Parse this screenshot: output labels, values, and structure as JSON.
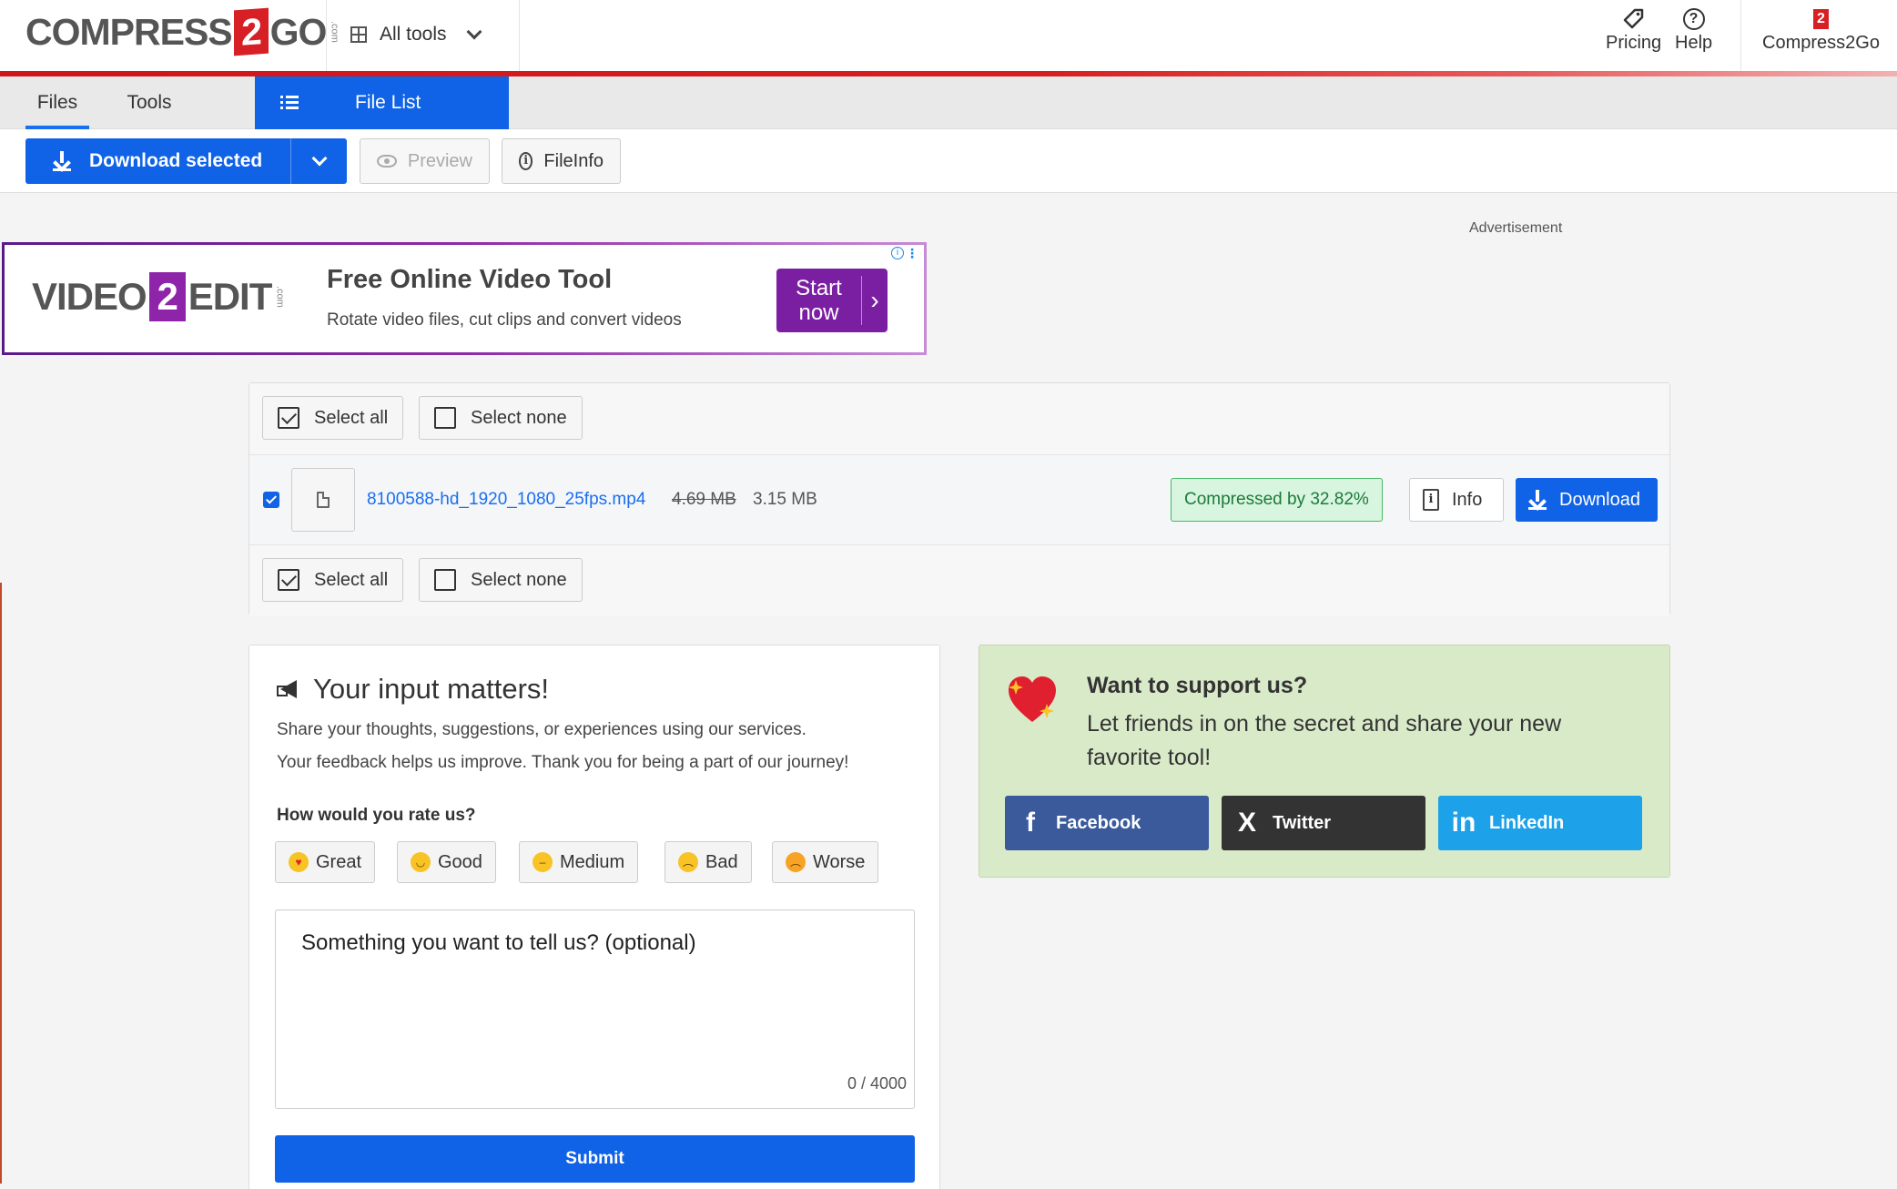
{
  "header": {
    "logo_left": "COMPRESS",
    "logo_num": "2",
    "logo_right": "GO",
    "logo_com": ".com",
    "all_tools": "All tools",
    "pricing": "Pricing",
    "help": "Help",
    "help_glyph": "?",
    "account_glyph": "2",
    "account": "Compress2Go"
  },
  "tabs": {
    "files": "Files",
    "tools": "Tools",
    "file_list": "File List"
  },
  "toolbar": {
    "download_selected": "Download selected",
    "preview": "Preview",
    "fileinfo": "FileInfo",
    "info_glyph": "i"
  },
  "ad": {
    "label": "Advertisement",
    "logo_left": "VIDEO",
    "logo_num": "2",
    "logo_right": "EDIT",
    "logo_com": ".com",
    "title": "Free Online Video Tool",
    "subtitle": "Rotate video files, cut clips and convert videos",
    "cta": "Start now",
    "cta_arrow": "›",
    "info_glyph": "i",
    "more_glyph": "⋮"
  },
  "file_list": {
    "select_all": "Select all",
    "select_none": "Select none",
    "files": [
      {
        "name": "8100588-hd_1920_1080_25fps.mp4",
        "original_size": "4.69 MB",
        "new_size": "3.15 MB",
        "status": "Compressed by 32.82%",
        "info_label": "Info",
        "info_glyph": "i",
        "download_label": "Download",
        "checked": true
      }
    ]
  },
  "feedback": {
    "title": "Your input matters!",
    "line1": "Share your thoughts, suggestions, or experiences using our services.",
    "line2": "Your feedback helps us improve. Thank you for being a part of our journey!",
    "rate_question": "How would you rate us?",
    "ratings": [
      {
        "label": "Great",
        "emoji": "♥"
      },
      {
        "label": "Good",
        "emoji": "◡"
      },
      {
        "label": "Medium",
        "emoji": "–"
      },
      {
        "label": "Bad",
        "emoji": "︵"
      },
      {
        "label": "Worse",
        "emoji": "︵"
      }
    ],
    "textarea_placeholder": "Something you want to tell us? (optional)",
    "counter": "0 / 4000",
    "submit": "Submit"
  },
  "support": {
    "title": "Want to support us?",
    "text": "Let friends in on the secret and share your new favorite tool!",
    "buttons": [
      {
        "label": "Facebook",
        "icon": "f",
        "color": "#3a5a9b"
      },
      {
        "label": "Twitter",
        "icon": "X",
        "color": "#333333"
      },
      {
        "label": "LinkedIn",
        "icon": "in",
        "color": "#1da1e8"
      }
    ]
  },
  "colors": {
    "accent": "#1062e6",
    "brand_red": "#d71f26",
    "success_bg": "#d7f5df",
    "support_bg": "#d9eac9",
    "ad_purple": "#7b1fa2"
  }
}
